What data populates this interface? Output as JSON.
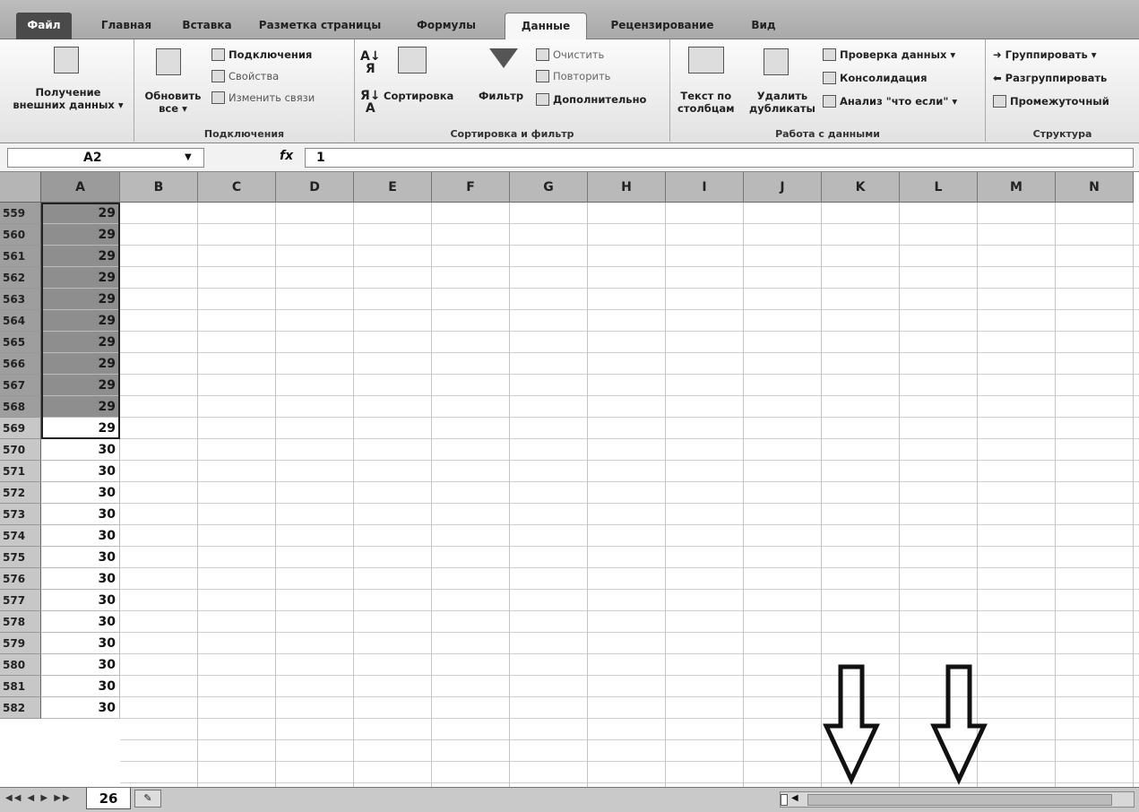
{
  "tabs": [
    {
      "label": "Файл"
    },
    {
      "label": "Главная"
    },
    {
      "label": "Вставка"
    },
    {
      "label": "Разметка страницы"
    },
    {
      "label": "Формулы"
    },
    {
      "label": "Данные"
    },
    {
      "label": "Рецензирование"
    },
    {
      "label": "Вид"
    }
  ],
  "ribbon": {
    "get_data": {
      "line1": "Получение",
      "line2": "внешних данных"
    },
    "connections": {
      "refresh_line1": "Обновить",
      "refresh_line2": "все",
      "connections": "Подключения",
      "properties": "Свойства",
      "edit_links": "Изменить связи",
      "group_label": "Подключения"
    },
    "sort_filter": {
      "sort": "Сортировка",
      "filter": "Фильтр",
      "clear": "Очистить",
      "reapply": "Повторить",
      "advanced": "Дополнительно",
      "group_label": "Сортировка и фильтр"
    },
    "data_tools": {
      "text_to_cols_line1": "Текст по",
      "text_to_cols_line2": "столбцам",
      "remove_dup_line1": "Удалить",
      "remove_dup_line2": "дубликаты",
      "validation": "Проверка данных",
      "consolidate": "Консолидация",
      "whatif": "Анализ \"что если\"",
      "group_label": "Работа с данными"
    },
    "outline": {
      "group": "Группировать",
      "ungroup": "Разгруппировать",
      "subtotal": "Промежуточный",
      "group_label": "Структура"
    }
  },
  "formula_bar": {
    "name_box": "A2",
    "fx": "fx",
    "value": "1"
  },
  "columns": [
    "A",
    "B",
    "C",
    "D",
    "E",
    "F",
    "G",
    "H",
    "I",
    "J",
    "K",
    "L",
    "M",
    "N"
  ],
  "rows": [
    {
      "num": "559",
      "a": "29",
      "selected": true
    },
    {
      "num": "560",
      "a": "29",
      "selected": true
    },
    {
      "num": "561",
      "a": "29",
      "selected": true
    },
    {
      "num": "562",
      "a": "29",
      "selected": true
    },
    {
      "num": "563",
      "a": "29",
      "selected": true
    },
    {
      "num": "564",
      "a": "29",
      "selected": true
    },
    {
      "num": "565",
      "a": "29",
      "selected": true
    },
    {
      "num": "566",
      "a": "29",
      "selected": true
    },
    {
      "num": "567",
      "a": "29",
      "selected": true
    },
    {
      "num": "568",
      "a": "29",
      "selected": true
    },
    {
      "num": "569",
      "a": "29",
      "selected": false
    },
    {
      "num": "570",
      "a": "30",
      "selected": false
    },
    {
      "num": "571",
      "a": "30",
      "selected": false
    },
    {
      "num": "572",
      "a": "30",
      "selected": false
    },
    {
      "num": "573",
      "a": "30",
      "selected": false
    },
    {
      "num": "574",
      "a": "30",
      "selected": false
    },
    {
      "num": "575",
      "a": "30",
      "selected": false
    },
    {
      "num": "576",
      "a": "30",
      "selected": false
    },
    {
      "num": "577",
      "a": "30",
      "selected": false
    },
    {
      "num": "578",
      "a": "30",
      "selected": false
    },
    {
      "num": "579",
      "a": "30",
      "selected": false
    },
    {
      "num": "580",
      "a": "30",
      "selected": false
    },
    {
      "num": "581",
      "a": "30",
      "selected": false
    },
    {
      "num": "582",
      "a": "30",
      "selected": false
    }
  ],
  "sheet_tab": "26",
  "icons": {
    "nav": "sheet-nav-arrows-icon",
    "new_sheet": "insert-sheet-icon",
    "annotation": "down-arrow-icon"
  }
}
